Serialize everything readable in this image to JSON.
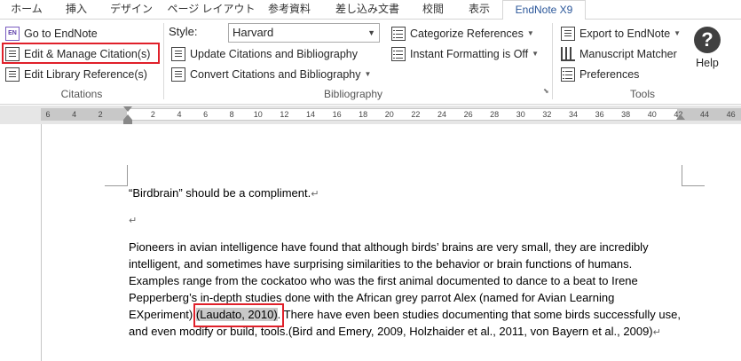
{
  "tabs": [
    {
      "label": "ホーム",
      "active": false
    },
    {
      "label": "挿入",
      "active": false
    },
    {
      "label": "デザイン",
      "active": false
    },
    {
      "label": "ページ レイアウト",
      "active": false
    },
    {
      "label": "参考資料",
      "active": false
    },
    {
      "label": "差し込み文書",
      "active": false
    },
    {
      "label": "校閲",
      "active": false
    },
    {
      "label": "表示",
      "active": false
    },
    {
      "label": "EndNote X9",
      "active": true
    }
  ],
  "citations": {
    "go_to_endnote": "Go to EndNote",
    "edit_manage": "Edit & Manage Citation(s)",
    "edit_library": "Edit Library Reference(s)",
    "group_label": "Citations"
  },
  "bibliography": {
    "style_label": "Style:",
    "style_value": "Harvard",
    "update": "Update Citations and Bibliography",
    "convert": "Convert Citations and Bibliography",
    "categorize": "Categorize References",
    "instant": "Instant Formatting is Off",
    "group_label": "Bibliography"
  },
  "tools": {
    "export": "Export to EndNote",
    "matcher": "Manuscript Matcher",
    "preferences": "Preferences",
    "group_label": "Tools"
  },
  "help": {
    "label": "Help",
    "glyph": "?"
  },
  "ruler": {
    "ticks": [
      "6",
      "4",
      "2",
      "",
      "2",
      "4",
      "6",
      "8",
      "10",
      "12",
      "14",
      "16",
      "18",
      "20",
      "22",
      "24",
      "26",
      "28",
      "30",
      "32",
      "34",
      "36",
      "38",
      "40",
      "42",
      "44",
      "46"
    ]
  },
  "document": {
    "para1": "“Birdbrain” should be a compliment.",
    "para2_a": "Pioneers in avian intelligence have found that although birds’ brains are very small, they are incredibly intelligent, and sometimes have surprising similarities to the behavior or brain functions of humans. Examples range from the cockatoo who was the first animal documented to dance to a beat to Irene Pepperberg’s in-depth studies done with the African grey parrot Alex (named for Avian Learning EXperiment) ",
    "para2_cite": "(Laudato, 2010)",
    "para2_b": ". There have even been studies documenting that some birds successfully use, and even modify or build, tools.(Bird and Emery, 2009, Holzhaider et al., 2011, von Bayern et al., 2009)"
  }
}
